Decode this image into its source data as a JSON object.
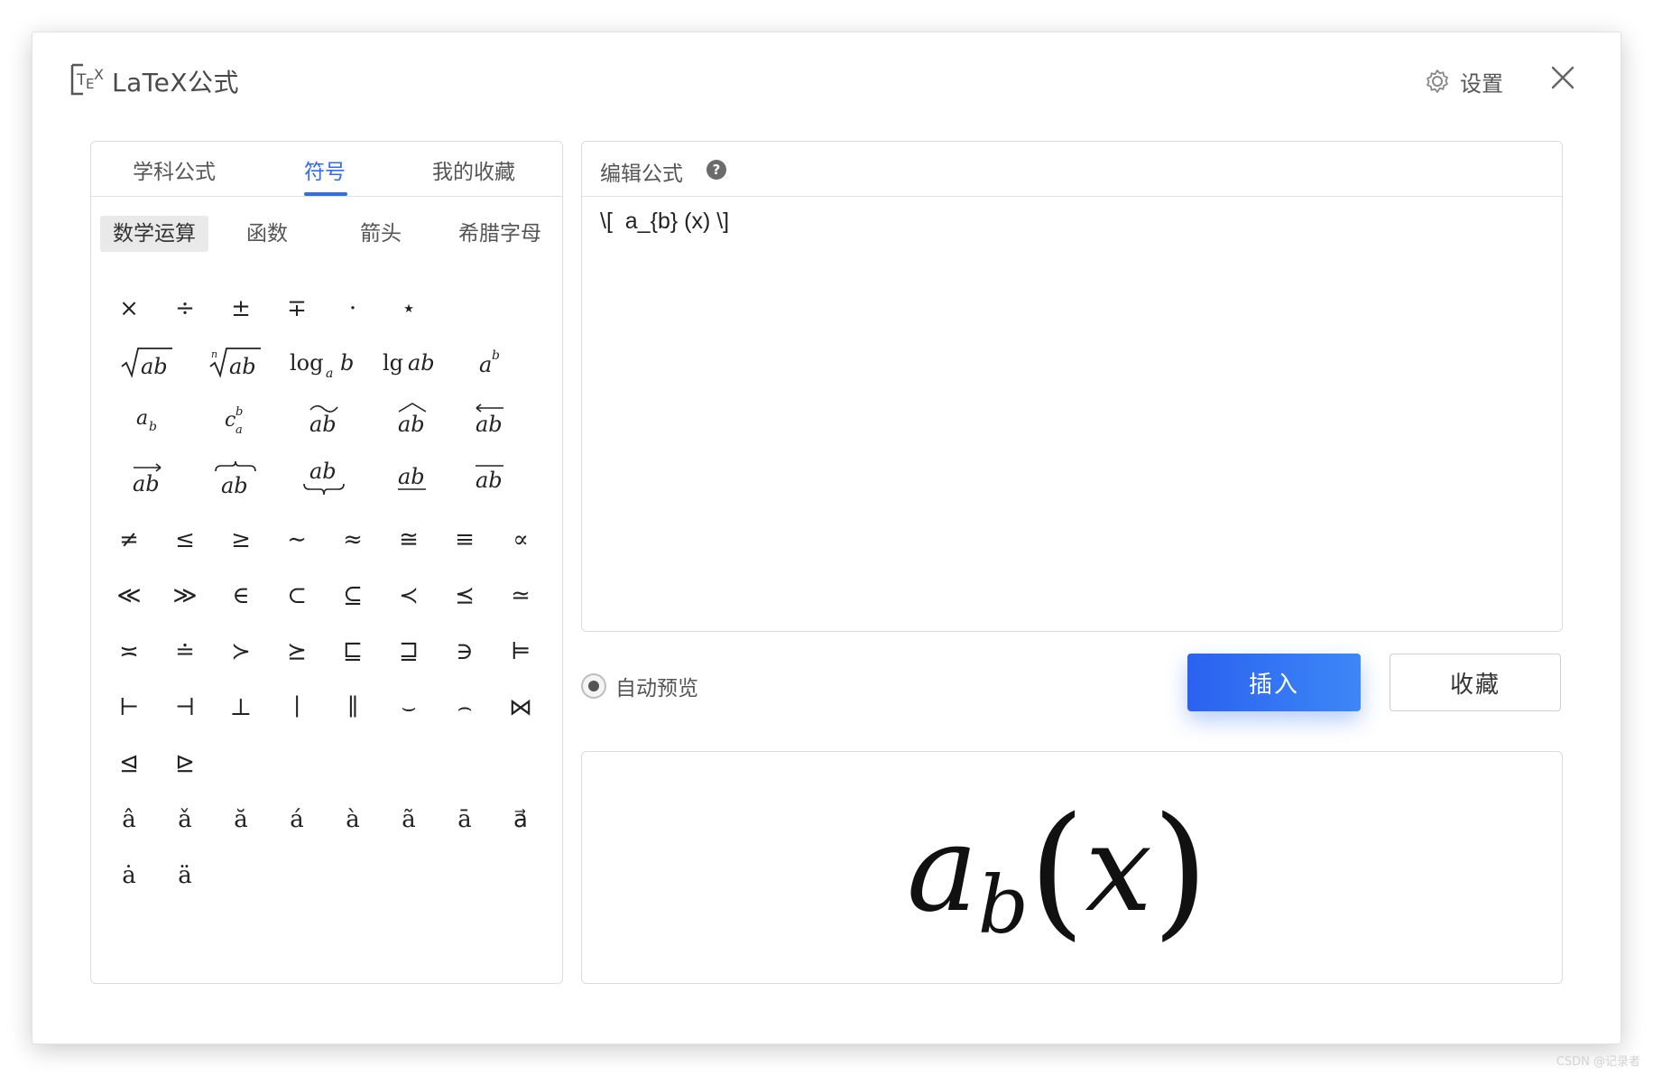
{
  "window": {
    "title": "LaTeX公式",
    "settings_label": "设置"
  },
  "panel": {
    "tabs": [
      {
        "label": "学科公式",
        "active": false
      },
      {
        "label": "符号",
        "active": true
      },
      {
        "label": "我的收藏",
        "active": false
      }
    ],
    "sub_tabs": [
      {
        "label": "数学运算",
        "active": true
      },
      {
        "label": "函数",
        "active": false
      },
      {
        "label": "箭头",
        "active": false
      },
      {
        "label": "希腊字母",
        "active": false
      }
    ],
    "symbols_row1": [
      "×",
      "÷",
      "±",
      "∓",
      "·",
      "⋆"
    ],
    "symbols_relations": [
      [
        "≠",
        "≤",
        "≥",
        "∼",
        "≈",
        "≅",
        "≡",
        "∝"
      ],
      [
        "≪",
        "≫",
        "∈",
        "⊂",
        "⊆",
        "≺",
        "⪯",
        "≃"
      ],
      [
        "≍",
        "≐",
        "≻",
        "⪰",
        "⊑",
        "⊒",
        "∋",
        "⊨"
      ],
      [
        "⊢",
        "⊣",
        "⊥",
        "∣",
        "∥",
        "⌣",
        "⌢",
        "⋈"
      ],
      [
        "⊴",
        "⊵"
      ]
    ],
    "accents": [
      [
        "â",
        "ǎ",
        "ă",
        "á",
        "à",
        "ã",
        "ā",
        "a⃗"
      ],
      [
        "ȧ",
        "ä"
      ]
    ]
  },
  "editor": {
    "title": "编辑公式",
    "help_icon_text": "?",
    "formula": "\\[  a_{b} (x) \\]"
  },
  "controls": {
    "auto_preview_label": "自动预览",
    "auto_preview_checked": true,
    "insert_label": "插入",
    "favorite_label": "收藏"
  },
  "preview": {
    "base": "a",
    "subscript": "b",
    "open_paren": "(",
    "argument": "x",
    "close_paren": ")"
  },
  "colors": {
    "accent": "#2f6cf0",
    "button_gradient_start": "#2a62ef",
    "button_gradient_end": "#3d87f7",
    "border": "#dcdcdc"
  },
  "watermark": "CSDN @记录者"
}
